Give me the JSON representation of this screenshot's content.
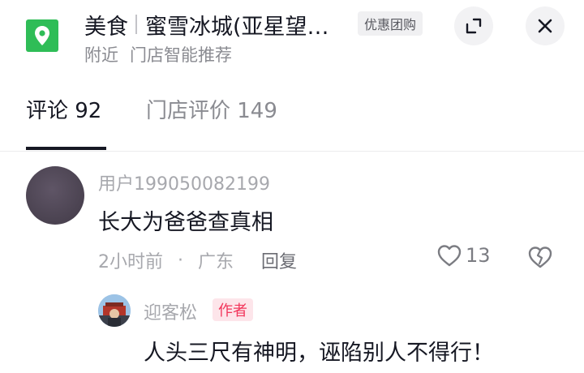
{
  "header": {
    "category": "美食",
    "store_name": "蜜雪冰城(亚星望…",
    "deal_tag": "优惠团购",
    "sub_items": [
      "附近",
      "门店智能推荐"
    ]
  },
  "tabs": [
    {
      "label": "评论 92"
    },
    {
      "label": "门店评价 149"
    }
  ],
  "comment": {
    "username": "用户199050082199",
    "text": "长大为爸爸查真相",
    "time": "2小时前",
    "dot": "·",
    "location": "广东",
    "reply_label": "回复",
    "likes": "13"
  },
  "reply": {
    "username": "迎客松",
    "badge": "作者",
    "text": "人头三尺有神明，诬陷别人不得行！"
  },
  "icons": {
    "location": "location-pin-icon",
    "expand": "expand-icon",
    "close": "close-icon",
    "like": "heart-outline-icon",
    "dislike": "broken-heart-icon"
  },
  "colors": {
    "location_badge": "#2fbd57",
    "author_badge_bg": "#fde5ea",
    "author_badge_text": "#f2365b"
  }
}
